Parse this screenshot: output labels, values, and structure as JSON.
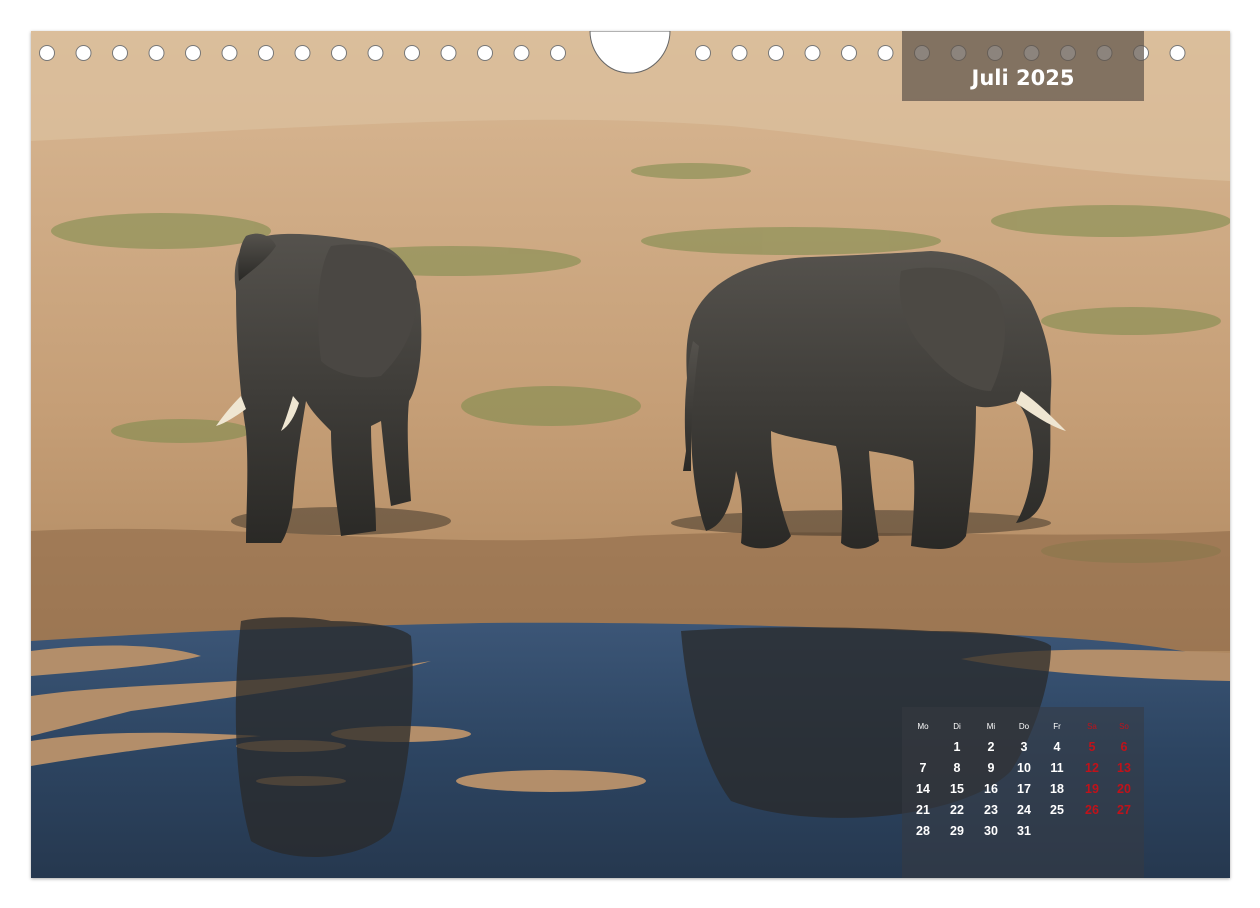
{
  "calendar": {
    "month_title": "Juli 2025",
    "weekday_headers": [
      "Mo",
      "Di",
      "Mi",
      "Do",
      "Fr",
      "Sa",
      "So"
    ],
    "weeks": [
      [
        "",
        "1",
        "2",
        "3",
        "4",
        "5",
        "6"
      ],
      [
        "7",
        "8",
        "9",
        "10",
        "11",
        "12",
        "13"
      ],
      [
        "14",
        "15",
        "16",
        "17",
        "18",
        "19",
        "20"
      ],
      [
        "21",
        "22",
        "23",
        "24",
        "25",
        "26",
        "27"
      ],
      [
        "28",
        "29",
        "30",
        "31",
        "",
        "",
        ""
      ]
    ],
    "weekend_color": "#c0121a",
    "weekday_color": "#ffffff"
  },
  "photo": {
    "ground_color": "#c9a27a",
    "water_color": "#2e4560",
    "elephant_color": "#3b3a38"
  },
  "binding": {
    "punch_hole_count_left": 15,
    "punch_hole_count_right": 14
  }
}
